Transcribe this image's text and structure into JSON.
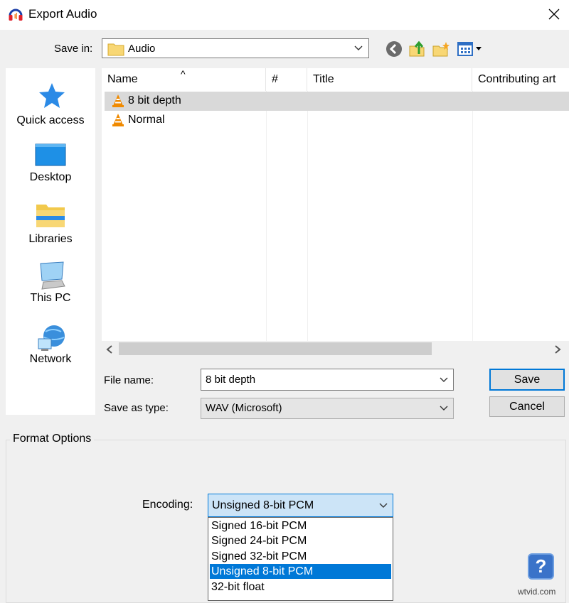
{
  "window": {
    "title": "Export Audio",
    "app_icon": "audacity-headphones-icon",
    "close_icon": "close-icon"
  },
  "toolbar": {
    "save_in_label": "Save in:",
    "save_in_value": "Audio",
    "buttons": [
      "back-icon",
      "up-folder-icon",
      "new-folder-icon",
      "view-menu-icon"
    ]
  },
  "places": [
    {
      "label": "Quick access",
      "icon": "star-icon"
    },
    {
      "label": "Desktop",
      "icon": "desktop-icon"
    },
    {
      "label": "Libraries",
      "icon": "libraries-icon"
    },
    {
      "label": "This PC",
      "icon": "computer-icon"
    },
    {
      "label": "Network",
      "icon": "network-icon"
    }
  ],
  "file_list": {
    "columns": [
      "Name",
      "#",
      "Title",
      "Contributing art"
    ],
    "sort_indicator": "^",
    "rows": [
      {
        "name": "8 bit depth",
        "selected": true
      },
      {
        "name": "Normal",
        "selected": false
      }
    ]
  },
  "form": {
    "file_name_label": "File name:",
    "file_name_value": "8 bit depth",
    "save_as_type_label": "Save as type:",
    "save_as_type_value": "WAV (Microsoft)",
    "save_label": "Save",
    "cancel_label": "Cancel"
  },
  "format_options": {
    "legend": "Format Options",
    "encoding_label": "Encoding:",
    "encoding_value": "Unsigned 8-bit PCM",
    "options": [
      "Signed 16-bit PCM",
      "Signed 24-bit PCM",
      "Signed 32-bit PCM",
      "Unsigned 8-bit PCM",
      "32-bit float"
    ],
    "selected_index": 3,
    "help_label": "?"
  },
  "watermark": "wtvid.com",
  "colors": {
    "accent": "#0078d7",
    "selection_row": "#d9d9d9"
  }
}
